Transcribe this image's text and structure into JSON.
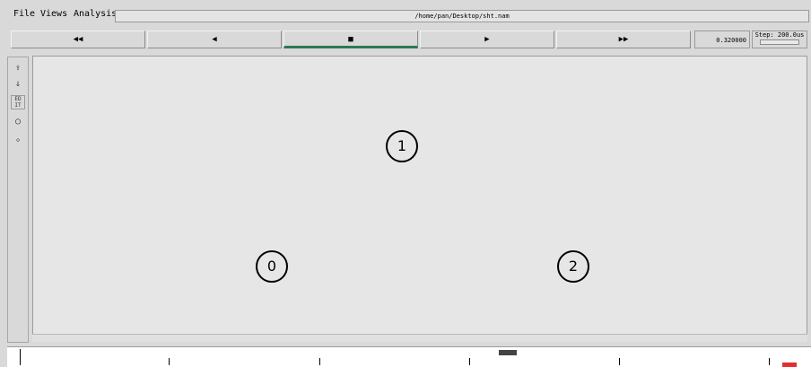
{
  "menu": {
    "file": "File",
    "views": "Views",
    "analysis": "Analysis"
  },
  "window": {
    "filepath": "/home/pan/Desktop/sht.nam"
  },
  "controls": {
    "rewind": "◀◀",
    "back": "◀",
    "stop": "■",
    "play": "▶",
    "forward": "▶▶",
    "time": "0.320000",
    "step": "Step: 200.0us"
  },
  "tools": {
    "edit": "ED IT"
  },
  "nodes": {
    "n0": "0",
    "n1": "1",
    "n2": "2"
  },
  "icons": [
    "zoom-in-icon",
    "zoom-out-icon",
    "edit-icon",
    "circle-node-icon",
    "small-node-icon"
  ]
}
